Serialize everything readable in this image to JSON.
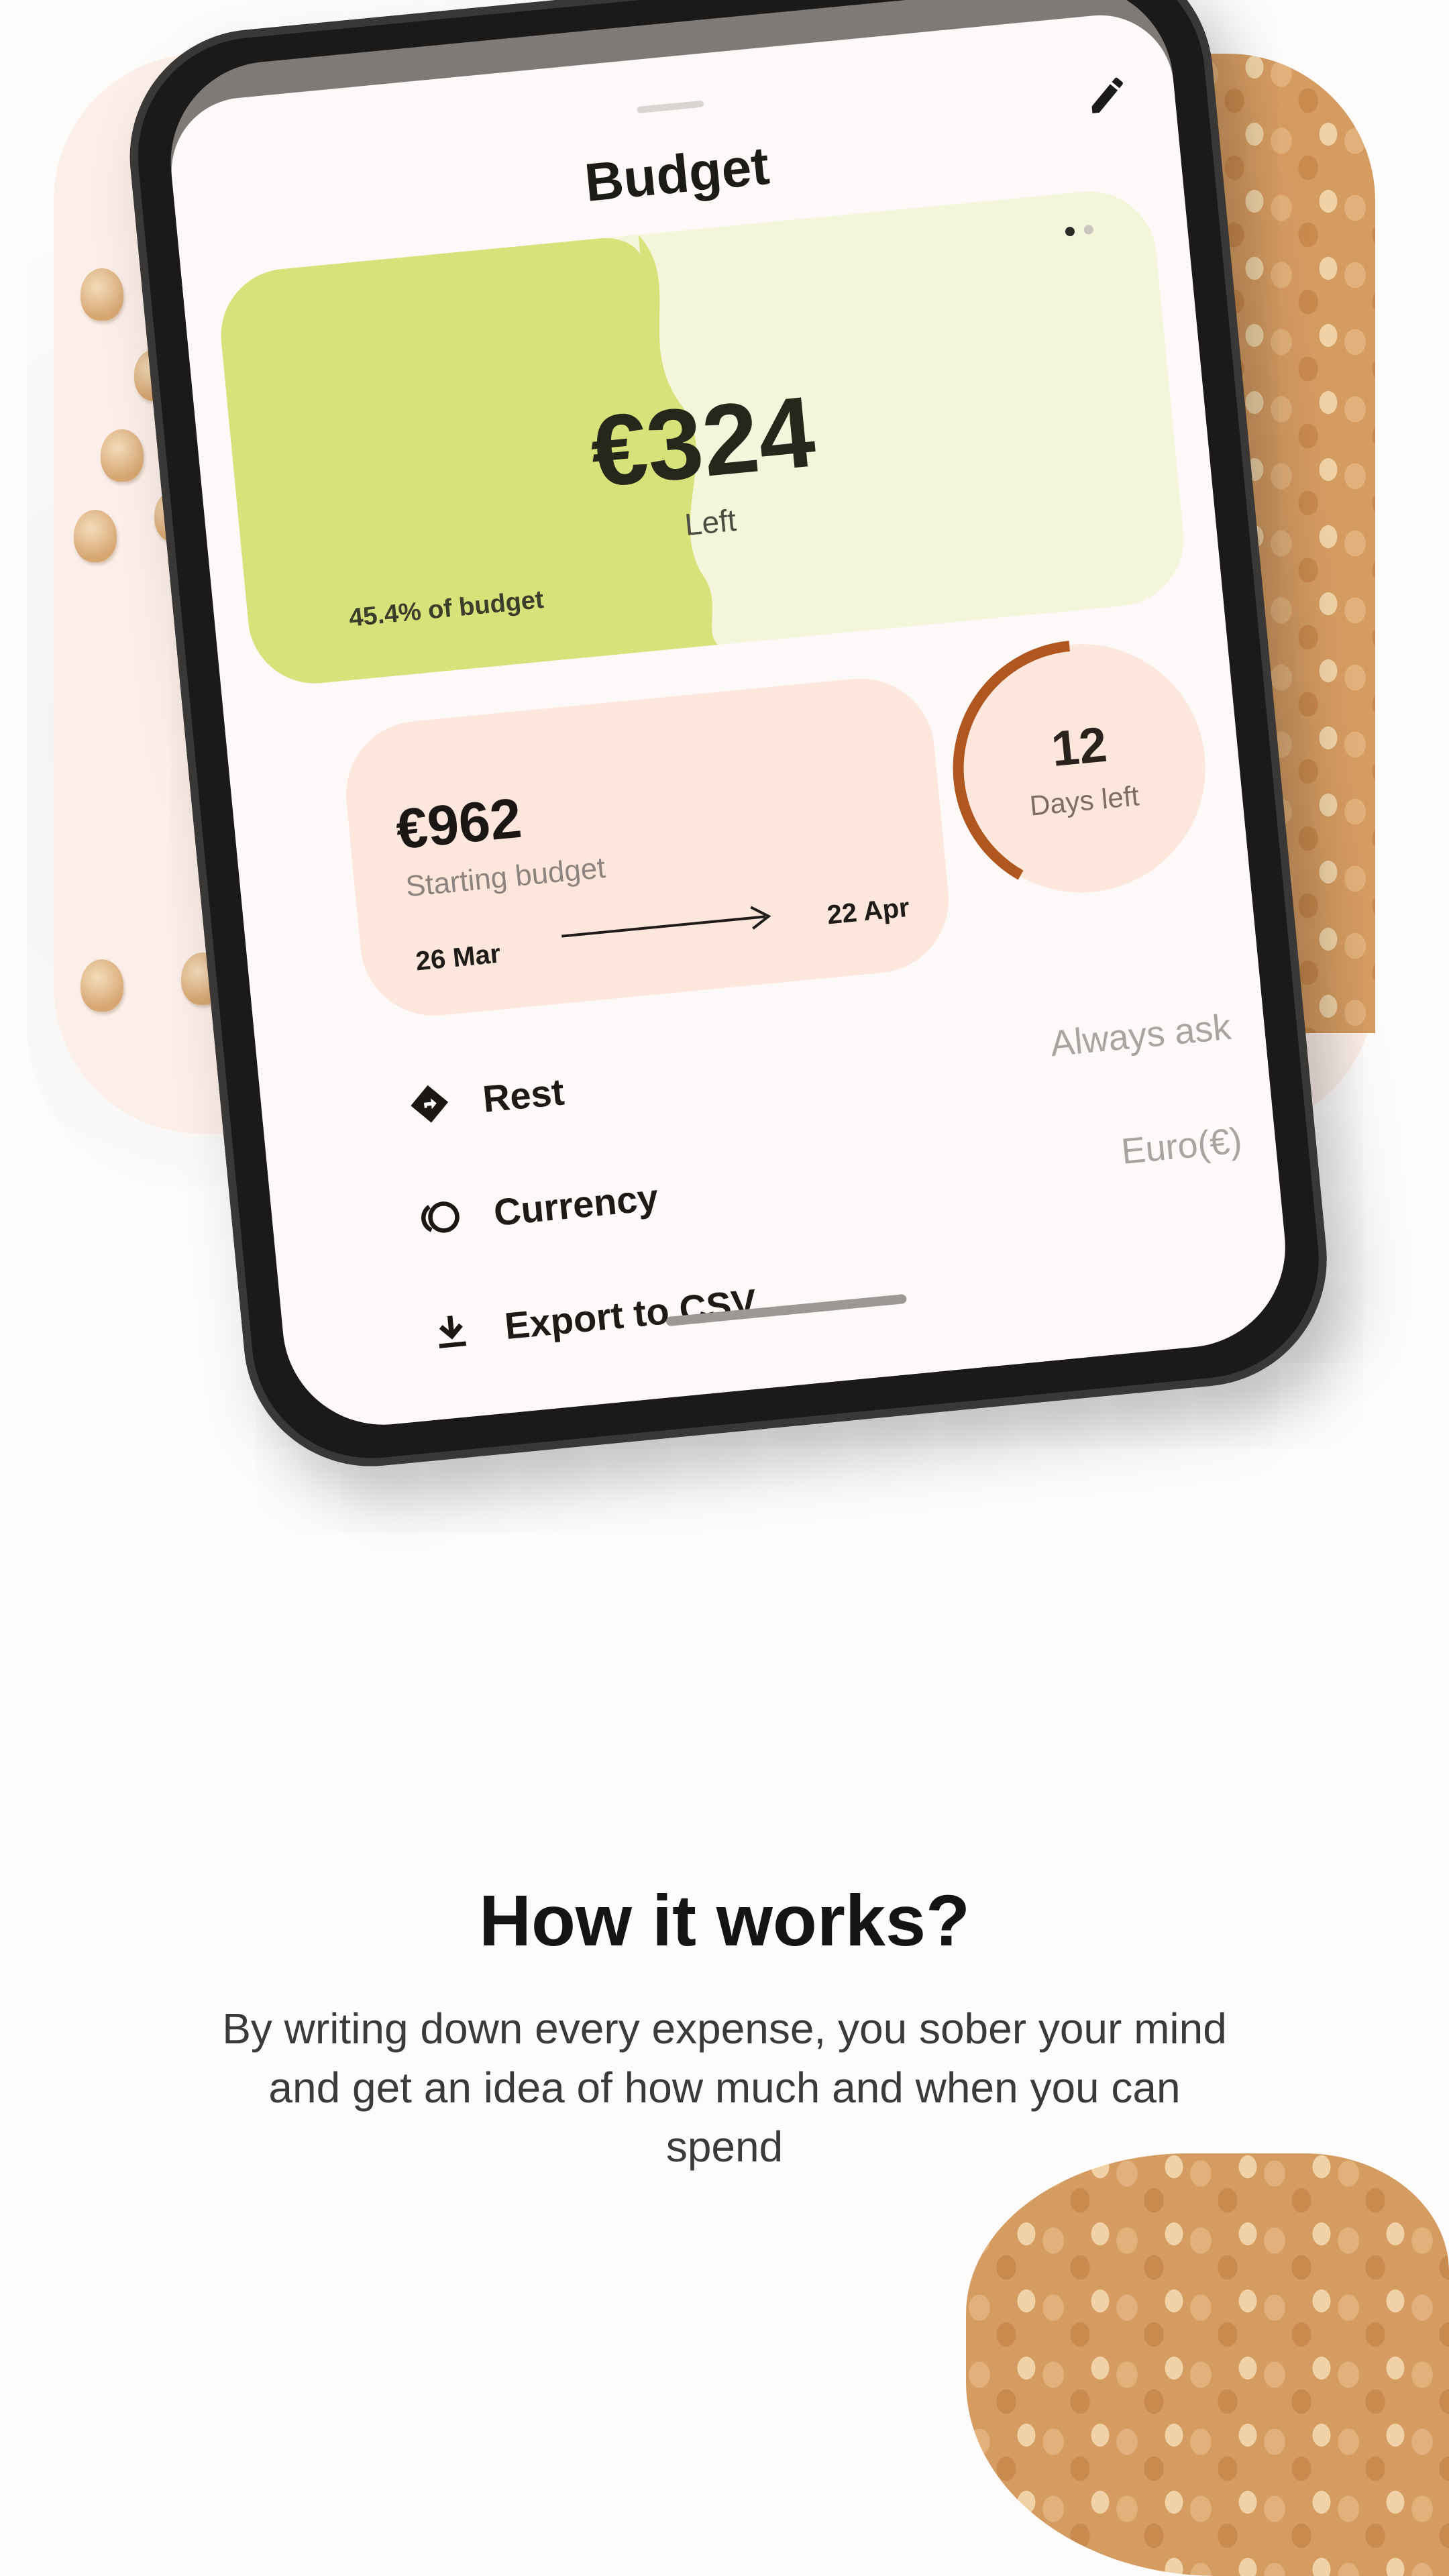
{
  "budget_sheet": {
    "title": "Budget",
    "remaining": {
      "amount": "€324",
      "label": "Left",
      "percent_text": "45.4% of budget",
      "percent_value": 45.4
    },
    "starting": {
      "amount": "€962",
      "label": "Starting budget",
      "date_from": "26 Mar",
      "date_to": "22 Apr"
    },
    "days": {
      "count": "12",
      "label": "Days left"
    },
    "settings": [
      {
        "label": "Rest",
        "value": "Always ask",
        "icon": "directions-icon"
      },
      {
        "label": "Currency",
        "value": "Euro(€)",
        "icon": "coins-icon"
      },
      {
        "label": "Export to CSV",
        "value": "",
        "icon": "download-icon"
      }
    ],
    "pager": {
      "count": 2,
      "active": 1
    }
  },
  "section": {
    "title": "How it works?",
    "text": "By writing down every expense, you sober your mind and get an idea of how much and when you can spend"
  },
  "colors": {
    "accent_green": "#d7e27a",
    "accent_peach": "#fde6dc",
    "ring_brown": "#b0561f"
  }
}
